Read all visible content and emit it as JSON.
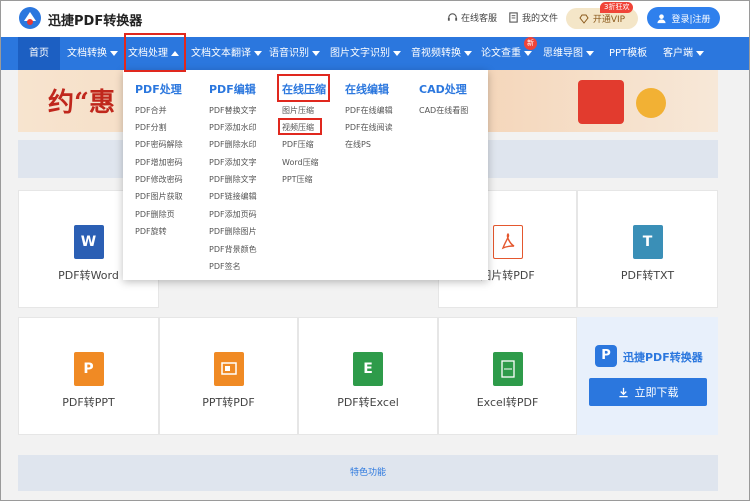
{
  "header": {
    "brand": "迅捷PDF转换器",
    "service": "在线客服",
    "files": "我的文件",
    "vip": "开通VIP",
    "vip_badge": "3折狂欢",
    "login": "登录|注册"
  },
  "nav": {
    "home": "首页",
    "items": [
      "文档转换",
      "文档处理",
      "文档文本翻译",
      "语音识别",
      "图片文字识别",
      "音视频转换",
      "论文查重",
      "思维导图",
      "PPT模板",
      "客户端"
    ],
    "new_badge": "新"
  },
  "banner": {
    "text": "约“惠"
  },
  "dropdown": {
    "columns": [
      {
        "title": "PDF处理",
        "items": [
          "PDF合并",
          "PDF分割",
          "PDF密码解除",
          "PDF增加密码",
          "PDF修改密码",
          "PDF图片获取",
          "PDF删除页",
          "PDF旋转"
        ]
      },
      {
        "title": "PDF编辑",
        "items": [
          "PDF替换文字",
          "PDF添加水印",
          "PDF删除水印",
          "PDF添加文字",
          "PDF删除文字",
          "PDF链接编辑",
          "PDF添加页码",
          "PDF删除图片",
          "PDF背景颜色",
          "PDF签名"
        ]
      },
      {
        "title": "在线压缩",
        "items": [
          "图片压缩",
          "视频压缩",
          "PDF压缩",
          "Word压缩",
          "PPT压缩"
        ]
      },
      {
        "title": "在线编辑",
        "items": [
          "PDF在线编辑",
          "PDF在线阅读",
          "在线PS"
        ]
      },
      {
        "title": "CAD处理",
        "items": [
          "CAD在线看图"
        ]
      }
    ]
  },
  "tools": {
    "row1": [
      {
        "label": "PDF转Word",
        "glyph": "W",
        "color": "#2b5fb4"
      },
      {
        "label": "图片转PDF",
        "glyph": "",
        "color": "#e4572e"
      },
      {
        "label": "PDF转TXT",
        "glyph": "T",
        "color": "#3a8fb7"
      }
    ],
    "row2": [
      {
        "label": "PDF转PPT",
        "glyph": "P",
        "color": "#f08a24"
      },
      {
        "label": "PPT转PDF",
        "glyph": "",
        "color": "#f08a24"
      },
      {
        "label": "PDF转Excel",
        "glyph": "E",
        "color": "#2e9b4a"
      },
      {
        "label": "Excel转PDF",
        "glyph": "",
        "color": "#2e9b4a"
      }
    ]
  },
  "download": {
    "brand": "迅捷PDF转换器",
    "button": "立即下载"
  },
  "feature_bar": "特色功能"
}
